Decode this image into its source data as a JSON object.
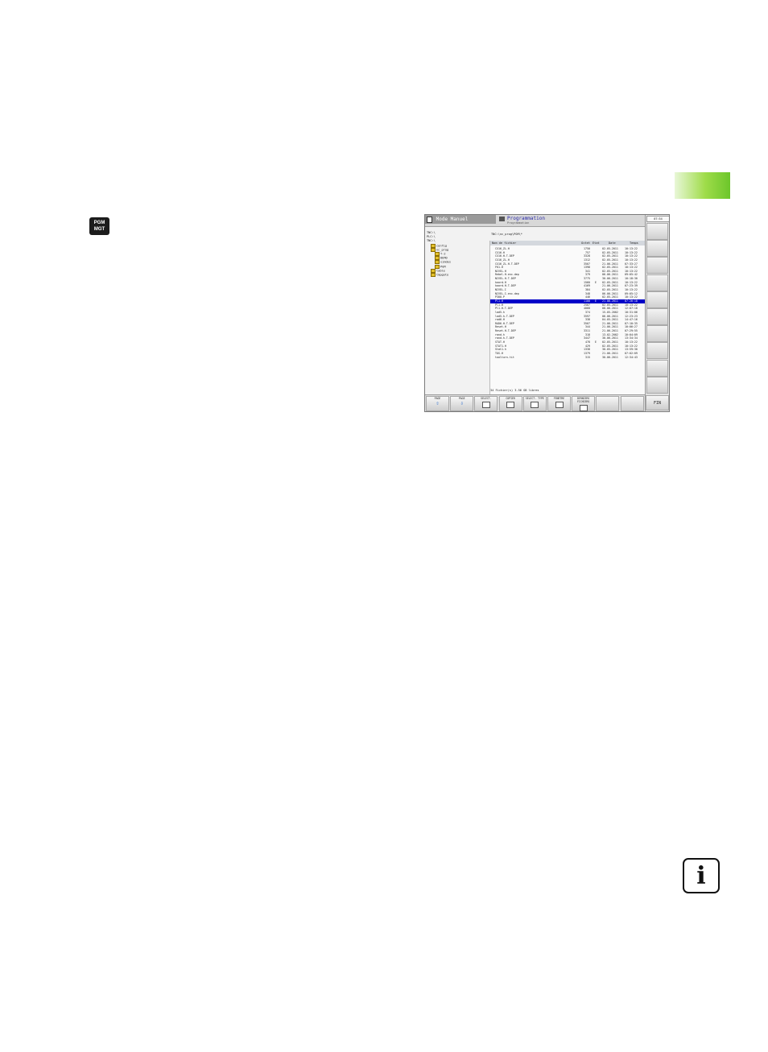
{
  "key": {
    "line1": "PGM",
    "line2": "MGT"
  },
  "screen": {
    "mode_left": "Mode Manuel",
    "mode_right_title": "Programmation",
    "mode_right_sub": "Programmation",
    "clock": "07:54",
    "path": "TNC:\\nc_prog\\PGM\\*",
    "tree": [
      {
        "label": "TNC:\\",
        "depth": 0,
        "folder": false
      },
      {
        "label": "PLC:\\",
        "depth": 0,
        "folder": false
      },
      {
        "label": "TNC:\\",
        "depth": 0,
        "folder": false
      },
      {
        "label": "config",
        "depth": 1,
        "folder": true
      },
      {
        "label": "nc_prog",
        "depth": 1,
        "folder": true
      },
      {
        "label": "T-2",
        "depth": 2,
        "folder": true
      },
      {
        "label": "DEMO",
        "depth": 2,
        "folder": true
      },
      {
        "label": "simdes",
        "depth": 2,
        "folder": true
      },
      {
        "label": "PGM",
        "depth": 2,
        "folder": true
      },
      {
        "label": "table",
        "depth": 1,
        "folder": true
      },
      {
        "label": "tmpgoto",
        "depth": 1,
        "folder": true
      }
    ],
    "columns": {
      "name": "Nom de fichier",
      "size": "Octet",
      "status": "Etat",
      "date": "Date",
      "time": "Temps"
    },
    "files": [
      {
        "name": "CX16_ZL.H",
        "size": "1750",
        "status": "",
        "date": "02-05-2011",
        "time": "10:13:22"
      },
      {
        "name": "CX16.H",
        "size": "757",
        "status": "",
        "date": "02-05-2011",
        "time": "10:13:22"
      },
      {
        "name": "CX16.H.T.DEP",
        "size": "3328",
        "status": "",
        "date": "02-05-2011",
        "time": "10:13:22"
      },
      {
        "name": "CX16_ZL.H",
        "size": "1312",
        "status": "",
        "date": "02-05-2011",
        "time": "10:13:22"
      },
      {
        "name": "CX16_ZL.H.T.DEP",
        "size": "3507",
        "status": "",
        "date": "21-06-2011",
        "time": "07:33:27"
      },
      {
        "name": "FK1.H",
        "size": "1398",
        "status": "",
        "date": "02-05-2011",
        "time": "10:13:22"
      },
      {
        "name": "NIVEL.H",
        "size": "341",
        "status": "",
        "date": "02-05-2011",
        "time": "10:13:22"
      },
      {
        "name": "Rebel.H.enc.dep",
        "size": "379",
        "status": "",
        "date": "06-06-2011",
        "time": "09:05:42"
      },
      {
        "name": "NIVEL.H.T.DEP",
        "size": "3775",
        "status": "",
        "date": "30-06-2011",
        "time": "10:18:30"
      },
      {
        "name": "koord.H",
        "size": "1560",
        "status": "E",
        "date": "02-05-2011",
        "time": "10:13:22"
      },
      {
        "name": "koord.H.T.DEP",
        "size": "4169",
        "status": "",
        "date": "21-06-2011",
        "time": "07:23:39"
      },
      {
        "name": "NIVEL.I",
        "size": "384",
        "status": "",
        "date": "02-05-2011",
        "time": "10:13:22"
      },
      {
        "name": "NIVEL.I.enc.dep",
        "size": "348",
        "status": "",
        "date": "06-06-2011",
        "time": "09:05:12"
      },
      {
        "name": "P300.P",
        "size": "446",
        "status": "",
        "date": "02-05-2011",
        "time": "10:13:22"
      },
      {
        "name": "Pl1.H",
        "size": "1100",
        "status": "E",
        "date": "21-06-2011",
        "time": "07:26:18",
        "selected": true
      },
      {
        "name": "Pl1.H",
        "size": "2507",
        "status": "",
        "date": "02-05-2011",
        "time": "10:13:22"
      },
      {
        "name": "Pl1.H.T.DEP",
        "size": "4068",
        "status": "",
        "date": "08-06-2011",
        "time": "12:07:18"
      },
      {
        "name": "lad5.h",
        "size": "374",
        "status": "",
        "date": "15-05-2002",
        "time": "10:31:06"
      },
      {
        "name": "lad5.h.T.DEP",
        "size": "3597",
        "status": "",
        "date": "06-06-2011",
        "time": "12:23:23"
      },
      {
        "name": "rad6.H",
        "size": "338",
        "status": "",
        "date": "04-05-2011",
        "time": "14:47:16"
      },
      {
        "name": "RAD6.H.T.DEP",
        "size": "3507",
        "status": "",
        "date": "21-06-2011",
        "time": "07:10:35"
      },
      {
        "name": "Reset.H",
        "size": "344",
        "status": "",
        "date": "21-06-2011",
        "time": "10:06:27"
      },
      {
        "name": "Reset.H.T.DEP",
        "size": "3311",
        "status": "",
        "date": "21-06-2011",
        "time": "07:29:55"
      },
      {
        "name": "rand.h",
        "size": "318",
        "status": "",
        "date": "13-02-2002",
        "time": "10:04:09"
      },
      {
        "name": "rand.h.T.DEP",
        "size": "3447",
        "status": "",
        "date": "30-06-2011",
        "time": "13:34:34"
      },
      {
        "name": "STAT.H",
        "size": "478",
        "status": "E",
        "date": "02-05-2011",
        "time": "10:13:22"
      },
      {
        "name": "STAT1.H",
        "size": "429",
        "status": "",
        "date": "02-05-2011",
        "time": "10:13:22"
      },
      {
        "name": "Stat1.h",
        "size": "1338",
        "status": "",
        "date": "30-05-2011",
        "time": "13:59:30"
      },
      {
        "name": "TOS.H",
        "size": "1379",
        "status": "",
        "date": "21-06-2011",
        "time": "07:02:09"
      },
      {
        "name": "toolturn.tit",
        "size": "315",
        "status": "",
        "date": "30-06-2011",
        "time": "12:34:43"
      }
    ],
    "footer": "34   Fichier(s)     3.56 GB libres",
    "softkeys": [
      {
        "label": "PAGE",
        "glyph": "⇧"
      },
      {
        "label": "PAGE",
        "glyph": "⇩"
      },
      {
        "label": "SELECT.",
        "glyph": ""
      },
      {
        "label": "COPIER",
        "glyph": ""
      },
      {
        "label": "SELECT. TYPE",
        "glyph": ""
      },
      {
        "label": "FENETRE",
        "glyph": ""
      },
      {
        "label": "DERNIERS FICHIERS",
        "glyph": ""
      },
      {
        "label": "",
        "glyph": ""
      },
      {
        "label": "",
        "glyph": ""
      },
      {
        "label": "FIN",
        "glyph": ""
      }
    ]
  }
}
